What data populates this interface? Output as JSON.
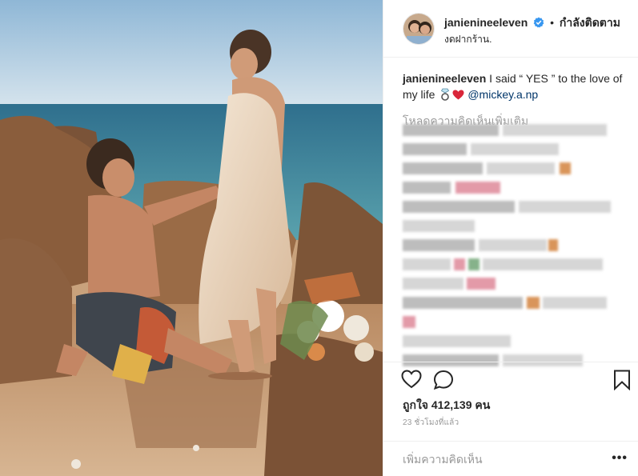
{
  "post": {
    "username": "janienineeleven",
    "follow_status": "กำลังติดตาม",
    "separator": "•",
    "location": "งดฝากร้าน."
  },
  "caption": {
    "username": "janienineeleven",
    "text": "I said “ YES ” to the love of my life",
    "mention": "@mickey.a.np"
  },
  "comments": {
    "load_more": "โหลดความคิดเห็นเพิ่มเติม"
  },
  "actions": {
    "likes": "ถูกใจ 412,139 คน",
    "timestamp": "23 ชั่วโมงที่แล้ว",
    "add_comment_placeholder": "เพิ่มความคิดเห็น",
    "more_label": "•••"
  },
  "icons": {
    "verified": "verified-badge-icon",
    "ring": "ring-emoji-icon",
    "heart": "red-heart-emoji-icon",
    "like": "heart-outline-icon",
    "comment": "comment-bubble-icon",
    "save": "bookmark-icon",
    "more": "more-options-icon"
  },
  "colors": {
    "verified": "#3897f0",
    "mention": "#003569",
    "muted": "#999999",
    "text": "#262626",
    "border": "#efefef"
  }
}
